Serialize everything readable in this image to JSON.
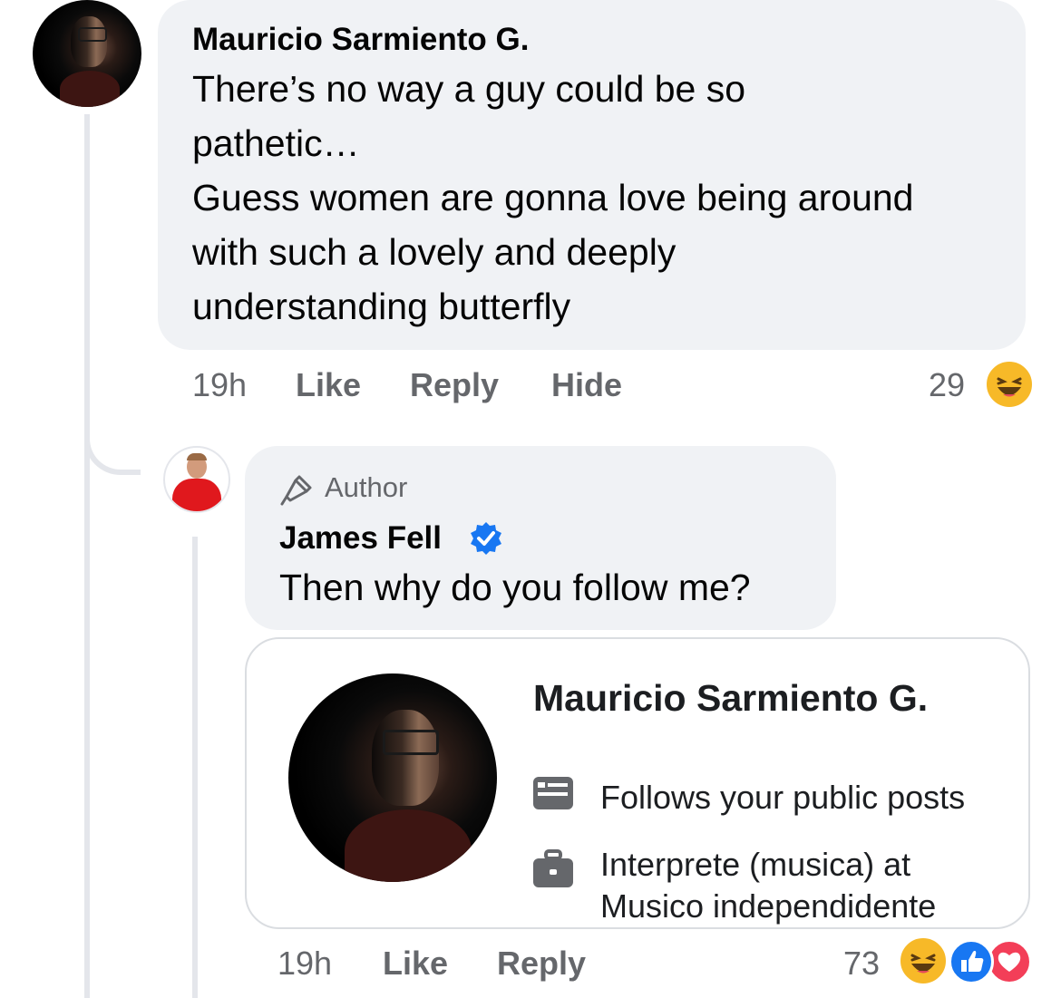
{
  "comment": {
    "author": "Mauricio Sarmiento G.",
    "text_lines": [
      "There’s no way a guy could be so",
      "pathetic…",
      "Guess women are gonna love being around",
      "with such a lovely and deeply",
      "understanding butterfly"
    ],
    "time": "19h",
    "like_label": "Like",
    "reply_label": "Reply",
    "hide_label": "Hide",
    "reaction_count": "29",
    "reaction_icons": [
      "haha-icon"
    ]
  },
  "reply": {
    "badge_label": "Author",
    "badge_icon": "microphone-icon",
    "author": "James Fell",
    "verified_icon": "verified-badge-icon",
    "text": "Then why do you follow me?",
    "card": {
      "name": "Mauricio Sarmiento G.",
      "follows_text": "Follows your public posts",
      "work_line_1": "Interprete (musica) at",
      "work_line_2": "Musico independidente"
    },
    "time": "19h",
    "like_label": "Like",
    "reply_label": "Reply",
    "reaction_count": "73",
    "reaction_icons": [
      "haha-icon",
      "like-icon",
      "love-icon"
    ]
  },
  "colors": {
    "bubble": "#f0f2f5",
    "meta": "#65676b",
    "verified": "#1877f2",
    "like": "#1877f2",
    "love": "#f33e58",
    "haha": "#f7b928"
  }
}
